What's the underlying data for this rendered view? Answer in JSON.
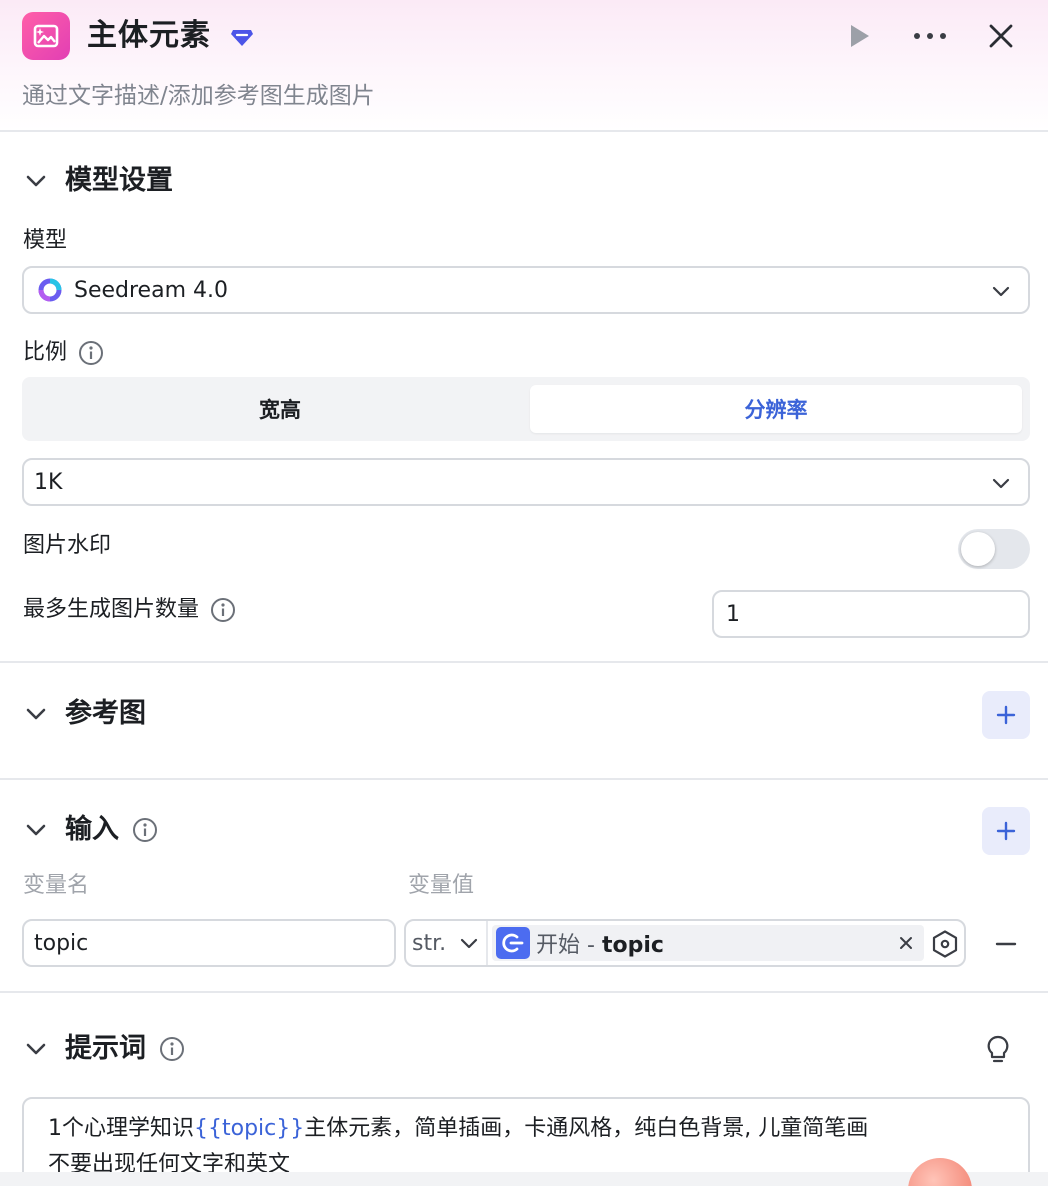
{
  "header": {
    "title": "主体元素",
    "subtitle": "通过文字描述/添加参考图生成图片",
    "app_icon": "image-sparkle-icon",
    "badge_icon": "diamond-badge-icon",
    "actions": [
      "play-icon",
      "more-icon",
      "close-icon"
    ]
  },
  "model_settings": {
    "section_title": "模型设置",
    "model_label": "模型",
    "model_value": "Seedream 4.0",
    "ratio_label": "比例",
    "ratio_tabs": [
      {
        "label": "宽高",
        "selected": false
      },
      {
        "label": "分辨率",
        "selected": true
      }
    ],
    "resolution_value": "1K",
    "watermark_label": "图片水印",
    "watermark_on": false,
    "max_images_label": "最多生成图片数量",
    "max_images_value": "1"
  },
  "reference": {
    "section_title": "参考图"
  },
  "inputs": {
    "section_title": "输入",
    "col_name": "变量名",
    "col_value": "变量值",
    "rows": [
      {
        "name": "topic",
        "type": "str.",
        "ref_source": "开始",
        "ref_separator": " - ",
        "ref_var": "topic"
      }
    ]
  },
  "prompt": {
    "section_title": "提示词",
    "line1_prefix": "1个心理学知识",
    "line1_var": "{{topic}}",
    "line1_suffix": "主体元素，简单插画，卡通风格，纯白色背景, 儿童简笔画",
    "line2": "不要出现任何文字和英文"
  },
  "colors": {
    "accent": "#3b63d8",
    "brand_pink": "#e23fb4",
    "ref_icon_blue": "#4c6cf0"
  }
}
